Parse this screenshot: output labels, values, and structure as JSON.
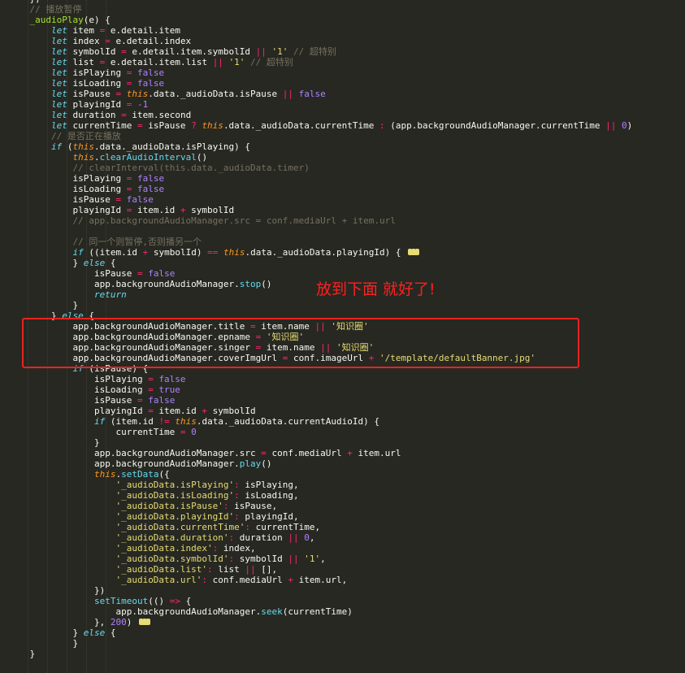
{
  "annotation": {
    "note": "放到下面 就好了!"
  },
  "colors": {
    "background": "#272822",
    "highlight_box": "#e8231f",
    "note": "#ff2020"
  },
  "code_lines": [
    "    },",
    "    // 播放暂停",
    "    _audioPlay(e) {",
    "        let item = e.detail.item",
    "        let index = e.detail.index",
    "        let symbolId = e.detail.item.symbolId || '1' // 超特别",
    "        let list = e.detail.item.list || '1' // 超特别",
    "        let isPlaying = false",
    "        let isLoading = false",
    "        let isPause = this.data._audioData.isPause || false",
    "        let playingId = -1",
    "        let duration = item.second",
    "        let currentTime = isPause ? this.data._audioData.currentTime : (app.backgroundAudioManager.currentTime || 0)",
    "        // 是否正在播放",
    "        if (this.data._audioData.isPlaying) {",
    "            this.clearAudioInterval()",
    "            // clearInterval(this.data._audioData.timer)",
    "            isPlaying = false",
    "            isLoading = false",
    "            isPause = false",
    "            playingId = item.id + symbolId",
    "            // app.backgroundAudioManager.src = conf.mediaUrl + item.url",
    "",
    "            // 同一个则暂停,否则播另一个",
    "            if ((item.id + symbolId) == this.data._audioData.playingId) {",
    "            } else {",
    "                isPause = false",
    "                app.backgroundAudioManager.stop()",
    "                return",
    "            }",
    "        } else {",
    "            app.backgroundAudioManager.title = item.name || '知识圈'",
    "            app.backgroundAudioManager.epname = '知识圈'",
    "            app.backgroundAudioManager.singer = item.name || '知识圈'",
    "            app.backgroundAudioManager.coverImgUrl = conf.imageUrl + '/template/defaultBanner.jpg'",
    "            if (isPause) {",
    "                isPlaying = false",
    "                isLoading = true",
    "                isPause = false",
    "                playingId = item.id + symbolId",
    "                if (item.id != this.data._audioData.currentAudioId) {",
    "                    currentTime = 0",
    "                }",
    "                app.backgroundAudioManager.src = conf.mediaUrl + item.url",
    "                app.backgroundAudioManager.play()",
    "                this.setData({",
    "                    '_audioData.isPlaying': isPlaying,",
    "                    '_audioData.isLoading': isLoading,",
    "                    '_audioData.isPause': isPause,",
    "                    '_audioData.playingId': playingId,",
    "                    '_audioData.currentTime': currentTime,",
    "                    '_audioData.duration': duration || 0,",
    "                    '_audioData.index': index,",
    "                    '_audioData.symbolId': symbolId || '1',",
    "                    '_audioData.list': list || [],",
    "                    '_audioData.url': conf.mediaUrl + item.url,",
    "                })",
    "                setTimeout(() => {",
    "                    app.backgroundAudioManager.seek(currentTime)",
    "                }, 200)",
    "            } else {",
    "            }",
    "    }"
  ]
}
